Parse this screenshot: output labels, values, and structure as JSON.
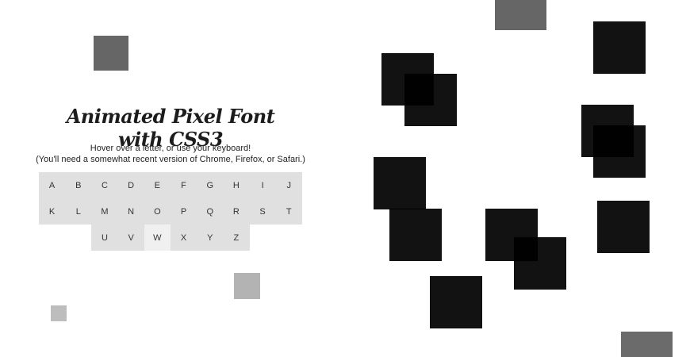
{
  "title": "Animated Pixel Font with CSS3",
  "subtitle_line1": "Hover over a letter, or use your keyboard!",
  "subtitle_line2": "(You'll need a somewhat recent version of Chrome, Firefox, or Safari.)",
  "keyboard": {
    "row1": [
      "A",
      "B",
      "C",
      "D",
      "E",
      "F",
      "G",
      "H",
      "I",
      "J"
    ],
    "row2": [
      "K",
      "L",
      "M",
      "N",
      "O",
      "P",
      "Q",
      "R",
      "S",
      "T"
    ],
    "row3": [
      "U",
      "V",
      "W",
      "X",
      "Y",
      "Z"
    ],
    "active_key": "W"
  },
  "colors": {
    "key_bg": "#e0e0e0",
    "key_active_bg": "#f0f0f0",
    "pixel": "#000000",
    "deco_dark": "#666666",
    "deco_light": "#b3b3b3"
  }
}
